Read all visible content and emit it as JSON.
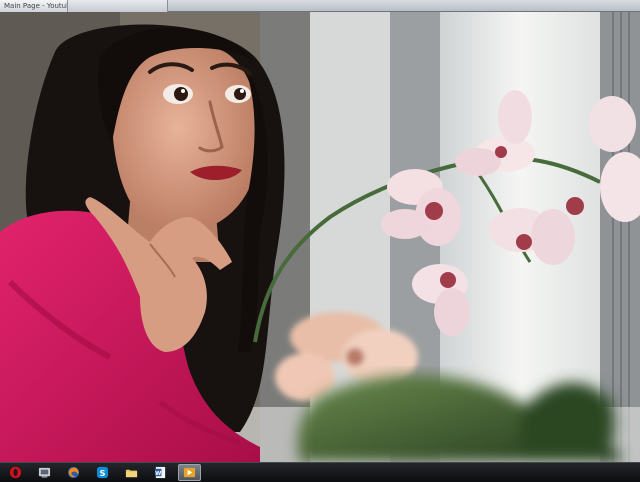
{
  "window": {
    "top_tab_label": "Main Page - Youtube"
  },
  "taskbar": {
    "items": [
      {
        "icon": "opera-icon"
      },
      {
        "icon": "media-player-icon"
      },
      {
        "icon": "firefox-icon"
      },
      {
        "icon": "skype-icon"
      },
      {
        "icon": "file-explorer-icon"
      },
      {
        "icon": "word-icon"
      },
      {
        "icon": "video-player-icon",
        "active": true
      }
    ]
  },
  "colors": {
    "robe": "#d4175f",
    "hair": "#17110f",
    "skin": "#d49a80",
    "orchid_petal": "#f4dfe3",
    "orchid_center": "#a13d4b",
    "taskbar": "#16181c"
  }
}
